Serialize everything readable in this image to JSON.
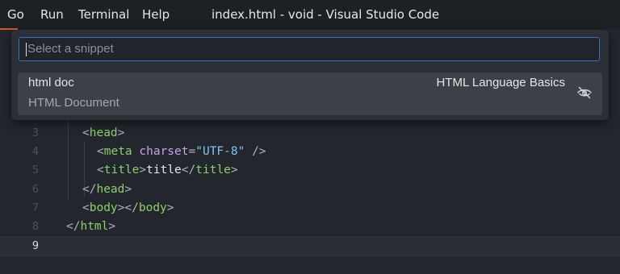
{
  "menubar": {
    "items": [
      "Go",
      "Run",
      "Terminal",
      "Help"
    ]
  },
  "window": {
    "title": "index.html - void - Visual Studio Code"
  },
  "quick_pick": {
    "placeholder": "Select a snippet",
    "items": [
      {
        "label": "html doc",
        "description": "HTML Document",
        "source": "HTML Language Basics",
        "action_icon": "eye-closed-icon"
      }
    ]
  },
  "editor": {
    "lines": [
      {
        "number": "3",
        "text": "<head>"
      },
      {
        "number": "4",
        "text": "<meta charset=\"UTF-8\" />"
      },
      {
        "number": "5",
        "text": "<title>title</title>"
      },
      {
        "number": "6",
        "text": "</head>"
      },
      {
        "number": "7",
        "text": "<body></body>"
      },
      {
        "number": "8",
        "text": "</html>"
      },
      {
        "number": "9",
        "text": ""
      }
    ],
    "active_line": "9"
  },
  "colors": {
    "accent_border": "#2f72c8",
    "tag": "#8bd06b",
    "attribute": "#c8a5ea",
    "string": "#7fc6f0",
    "title_accent": "#d4582b"
  }
}
